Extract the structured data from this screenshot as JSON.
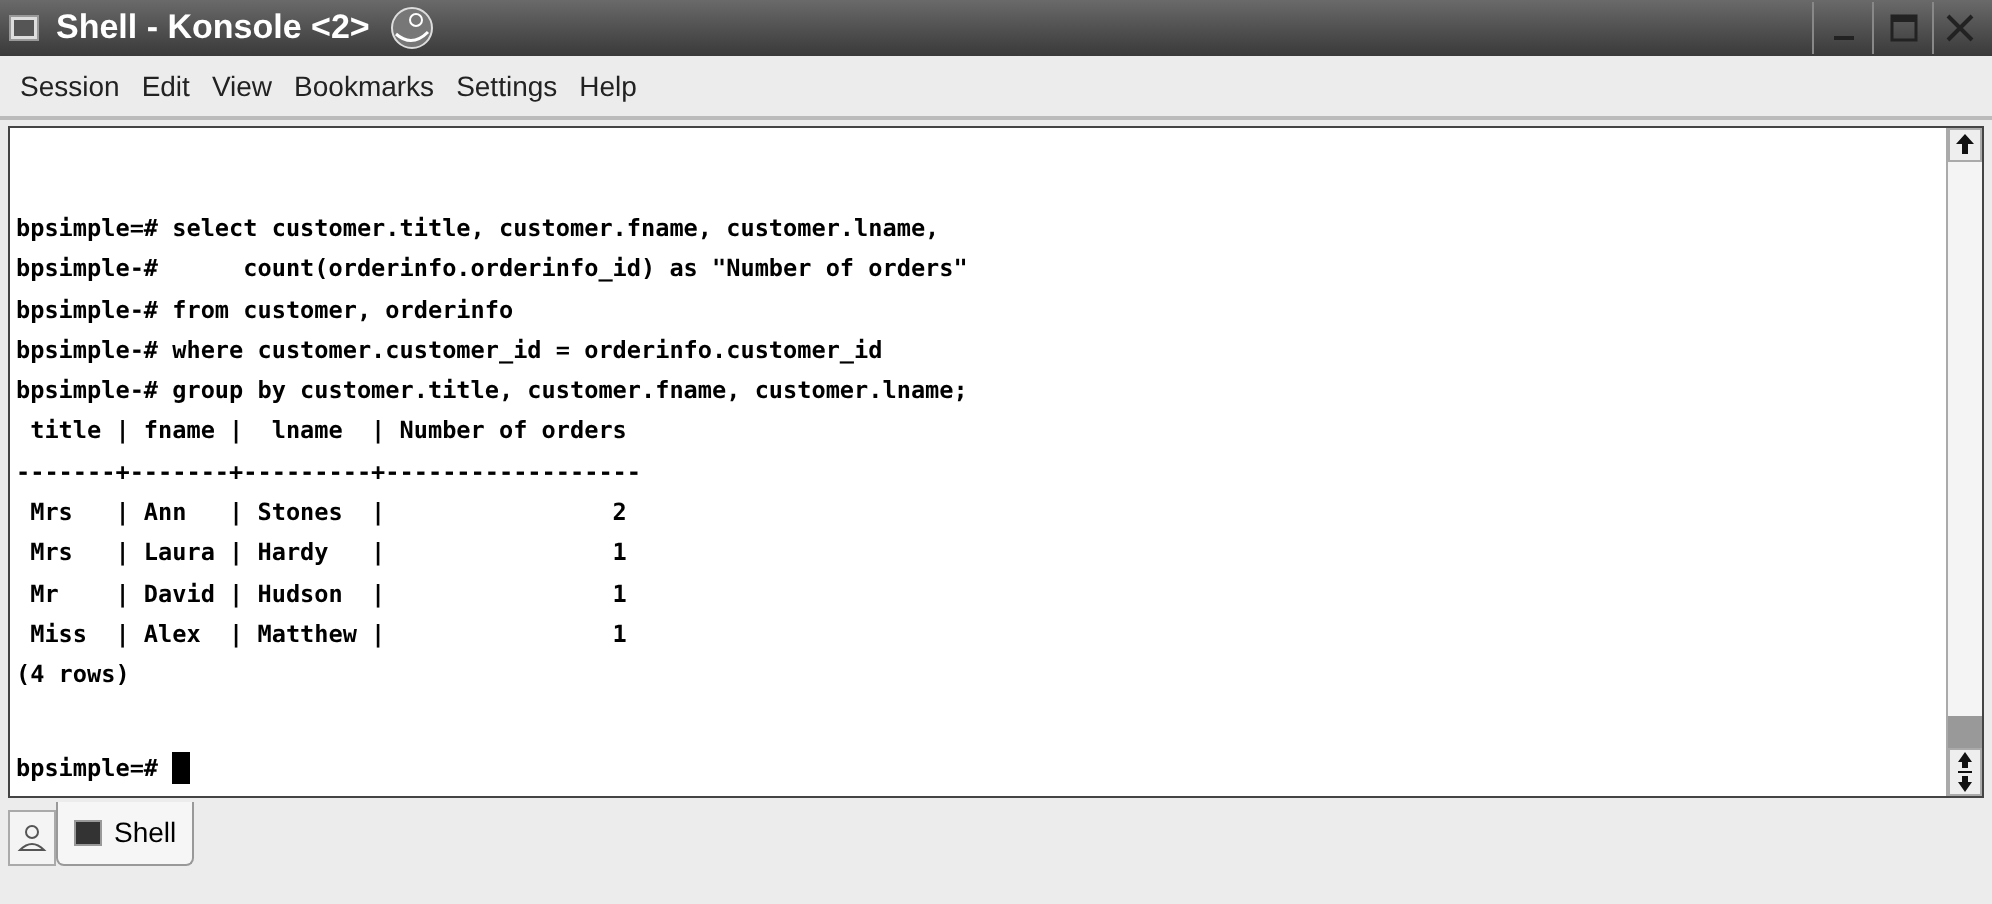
{
  "window": {
    "title": "Shell - Konsole <2>"
  },
  "menu": [
    "Session",
    "Edit",
    "View",
    "Bookmarks",
    "Settings",
    "Help"
  ],
  "terminal": {
    "lines": [
      "bpsimple=# select customer.title, customer.fname, customer.lname,",
      "bpsimple-#      count(orderinfo.orderinfo_id) as \"Number of orders\"",
      "bpsimple-# from customer, orderinfo",
      "bpsimple-# where customer.customer_id = orderinfo.customer_id",
      "bpsimple-# group by customer.title, customer.fname, customer.lname;",
      " title | fname |  lname  | Number of orders",
      "-------+-------+---------+------------------",
      " Mrs   | Ann   | Stones  |                2",
      " Mrs   | Laura | Hardy   |                1",
      " Mr    | David | Hudson  |                1",
      " Miss  | Alex  | Matthew |                1",
      "(4 rows)"
    ],
    "prompt": {
      "text": "bpsimple=# ",
      "cursor": true
    }
  },
  "tabs": [
    {
      "label": "Shell",
      "selected": true
    }
  ]
}
